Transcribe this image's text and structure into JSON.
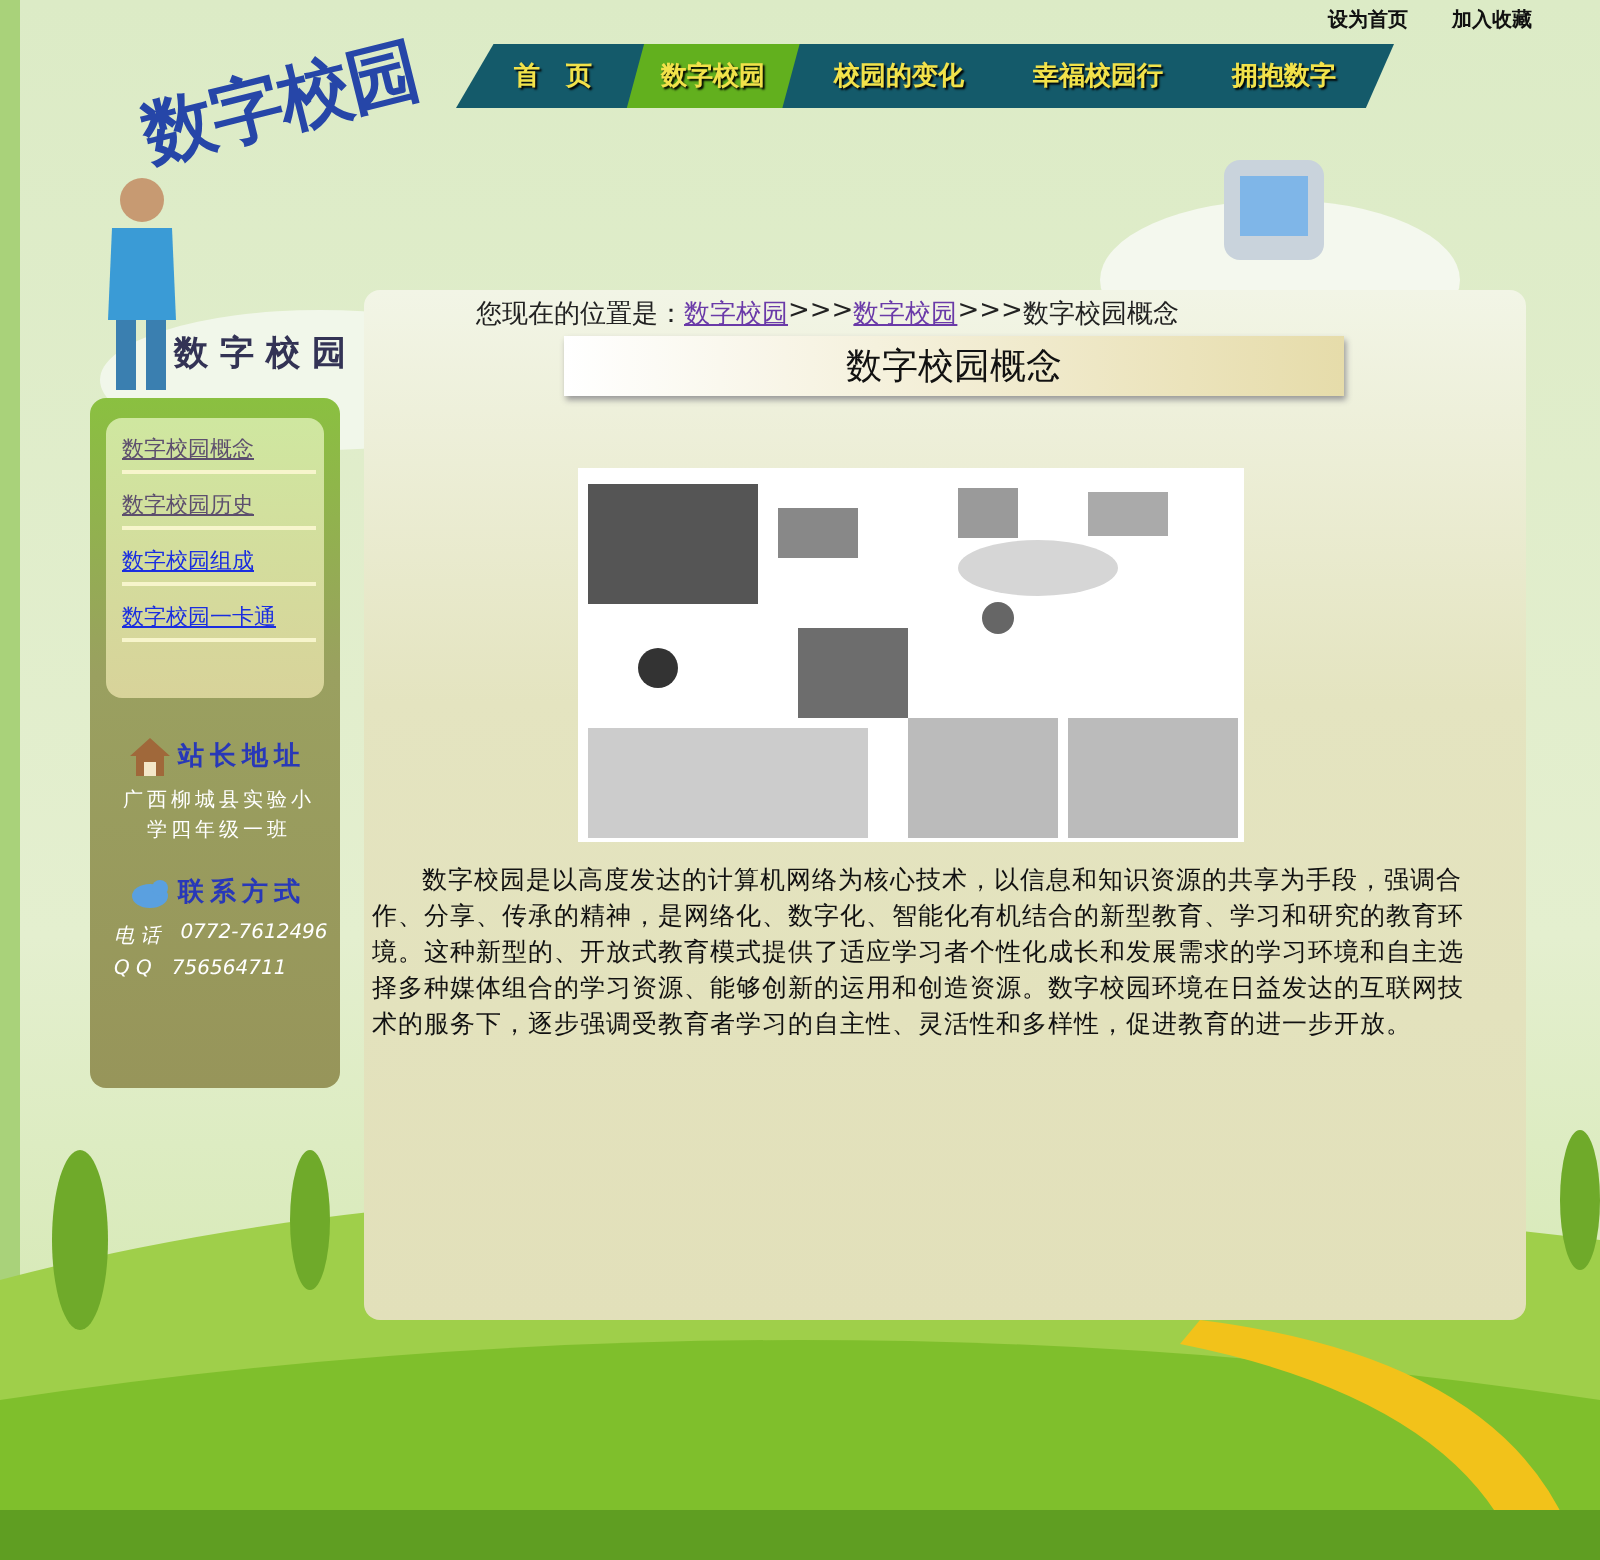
{
  "top_links": [
    "设为首页",
    "加入收藏"
  ],
  "logo": "数字校园",
  "nav": [
    {
      "label": "首　页",
      "selected": false
    },
    {
      "label": "数字校园",
      "selected": true
    },
    {
      "label": "校园的变化",
      "selected": false
    },
    {
      "label": "幸福校园行",
      "selected": false
    },
    {
      "label": "拥抱数字",
      "selected": false
    }
  ],
  "cloud_title": "数 字 校 园",
  "sidebar": {
    "links": [
      {
        "label": "数字校园概念",
        "visited": true
      },
      {
        "label": "数字校园历史",
        "visited": true
      },
      {
        "label": "数字校园组成",
        "visited": false
      },
      {
        "label": "数字校园一卡通",
        "visited": false
      }
    ],
    "address_heading": "站长地址",
    "address": "广西柳城县实验小学四年级一班",
    "contact_heading": "联系方式",
    "contacts": [
      {
        "label": "电 话",
        "value": "0772-7612496"
      },
      {
        "label": "Q Q",
        "value": "756564711"
      }
    ]
  },
  "breadcrumb": {
    "prefix": "您现在的位置是：",
    "links": [
      "数字校园",
      "数字校园"
    ],
    "separator": ">>>",
    "current": "数字校园概念"
  },
  "title": "数字校园概念",
  "paragraph": "数字校园是以高度发达的计算机网络为核心技术，以信息和知识资源的共享为手段，强调合作、分享、传承的精神，是网络化、数字化、智能化有机结合的新型教育、学习和研究的教育环境。这种新型的、开放式教育模式提供了适应学习者个性化成长和发展需求的学习环境和自主选择多种媒体组合的学习资源、能够创新的运用和创造资源。数字校园环境在日益发达的互联网技术的服务下，逐步强调受教育者学习的自主性、灵活性和多样性，促进教育的进一步开放。"
}
